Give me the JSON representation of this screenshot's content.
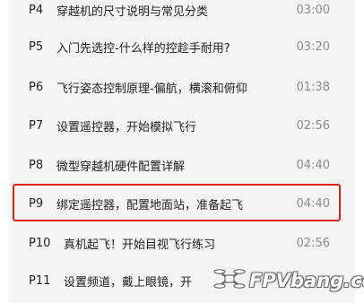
{
  "playlist": {
    "items": [
      {
        "num": "P4",
        "title": "穿越机的尺寸说明与常见分类",
        "duration": "03:00"
      },
      {
        "num": "P5",
        "title": "入门先选控-什么样的控趁手耐用?",
        "duration": "03:20"
      },
      {
        "num": "P6",
        "title": "飞行姿态控制原理-偏航，横滚和俯仰",
        "duration": "01:38"
      },
      {
        "num": "P7",
        "title": "设置遥控器，开始模拟飞行",
        "duration": "02:56"
      },
      {
        "num": "P8",
        "title": "微型穿越机硬件配置详解",
        "duration": "04:40"
      },
      {
        "num": "P9",
        "title": "绑定遥控器，配置地面站，准备起飞",
        "duration": "04:40"
      },
      {
        "num": "P10",
        "title": "真机起飞！开始目视飞行练习",
        "duration": "02:56"
      },
      {
        "num": "P11",
        "title": "设置频道，戴上眼镜，开",
        "duration": ""
      }
    ]
  },
  "highlight": {
    "item_index": 5,
    "color": "#e02020"
  },
  "watermark": {
    "text": "FPVbang.com",
    "icon": "drone-icon"
  },
  "colors": {
    "list_bg": "#f4f4f4",
    "text": "#222222",
    "duration": "#8c8c8c"
  }
}
